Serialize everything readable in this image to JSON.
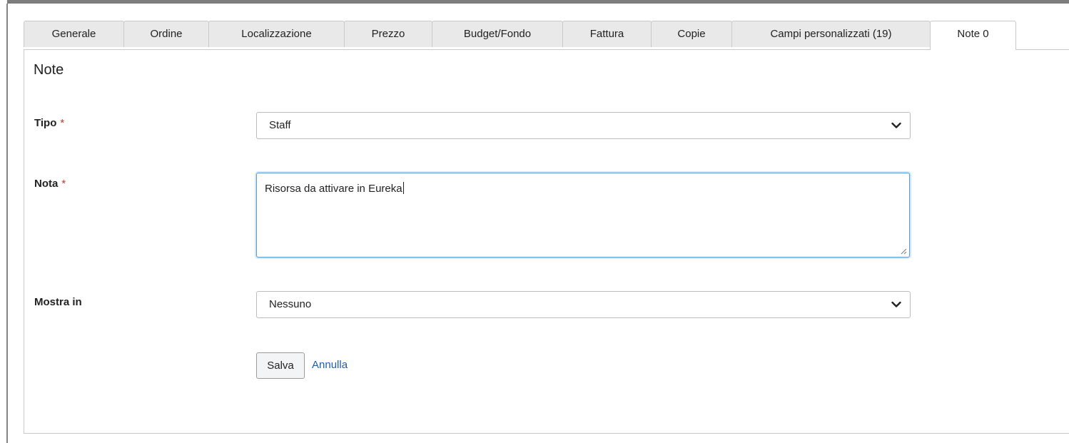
{
  "tabs": [
    {
      "label": "Generale"
    },
    {
      "label": "Ordine"
    },
    {
      "label": "Localizzazione"
    },
    {
      "label": "Prezzo"
    },
    {
      "label": "Budget/Fondo"
    },
    {
      "label": "Fattura"
    },
    {
      "label": "Copie"
    },
    {
      "label": "Campi personalizzati (19)"
    },
    {
      "label": "Note 0"
    }
  ],
  "active_tab": "Note 0",
  "panel": {
    "title": "Note"
  },
  "form": {
    "tipo": {
      "label": "Tipo",
      "required_mark": "*",
      "value": "Staff"
    },
    "nota": {
      "label": "Nota",
      "required_mark": "*",
      "value": "Risorsa da attivare in Eureka"
    },
    "mostra_in": {
      "label": "Mostra in",
      "value": "Nessuno"
    }
  },
  "actions": {
    "save_label": "Salva",
    "cancel_label": "Annulla"
  },
  "colors": {
    "required": "#c0392b",
    "link": "#1f5fa8",
    "focus_border": "#5b9bd5"
  }
}
